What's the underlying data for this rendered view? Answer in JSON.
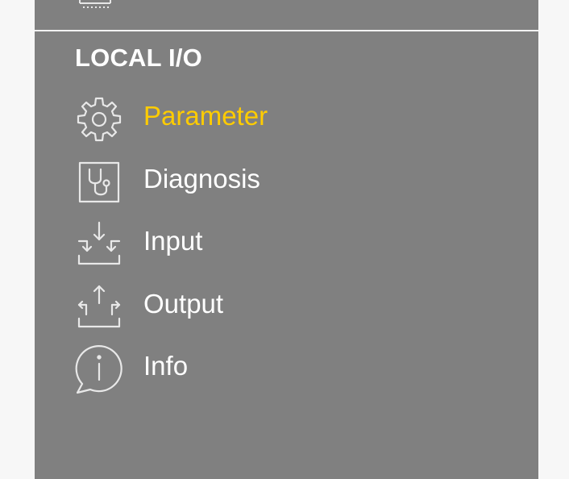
{
  "section": {
    "title": "LOCAL I/O"
  },
  "menu": {
    "items": [
      {
        "label": "Parameter",
        "icon": "gear-icon",
        "active": true
      },
      {
        "label": "Diagnosis",
        "icon": "stethoscope-icon",
        "active": false
      },
      {
        "label": "Input",
        "icon": "input-arrows-icon",
        "active": false
      },
      {
        "label": "Output",
        "icon": "output-arrows-icon",
        "active": false
      },
      {
        "label": "Info",
        "icon": "info-icon",
        "active": false
      }
    ]
  },
  "colors": {
    "panel_background": "#808080",
    "page_background": "#f7f7f7",
    "active_label": "#ffcc00",
    "label": "#ffffff"
  }
}
